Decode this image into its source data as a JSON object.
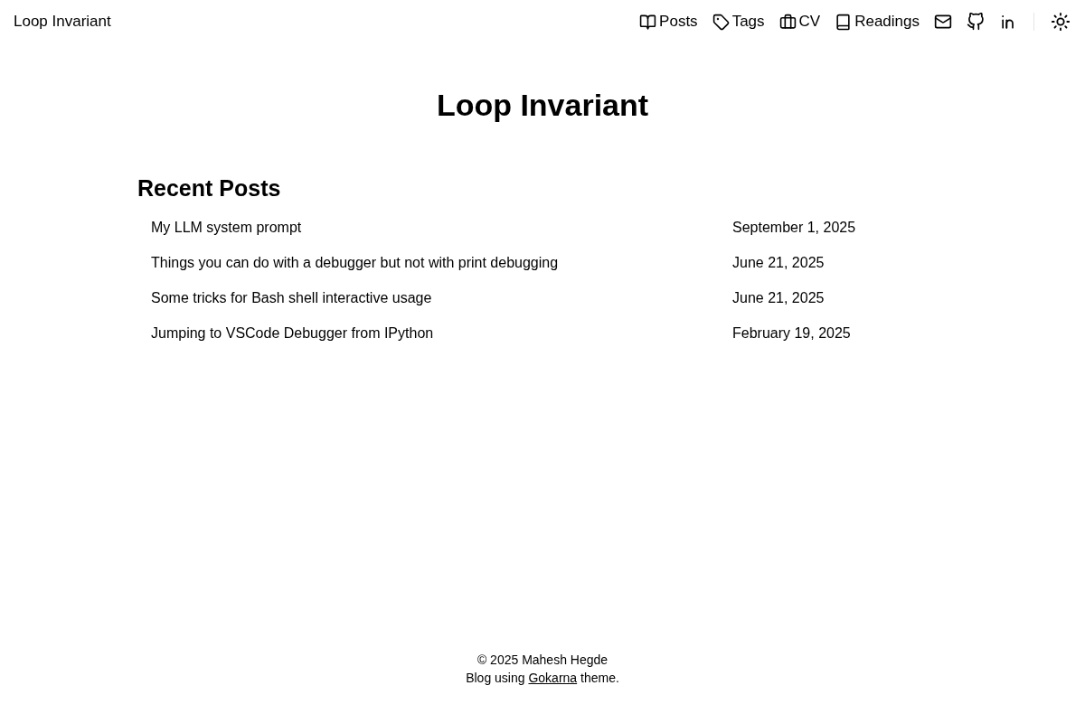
{
  "header": {
    "site_title": "Loop Invariant",
    "nav": [
      {
        "label": "Posts"
      },
      {
        "label": "Tags"
      },
      {
        "label": "CV"
      },
      {
        "label": "Readings"
      }
    ]
  },
  "main": {
    "title": "Loop Invariant",
    "section_title": "Recent Posts",
    "posts": [
      {
        "title": "My LLM system prompt",
        "date": "September 1, 2025"
      },
      {
        "title": "Things you can do with a debugger but not with print debugging",
        "date": "June 21, 2025"
      },
      {
        "title": "Some tricks for Bash shell interactive usage",
        "date": "June 21, 2025"
      },
      {
        "title": "Jumping to VSCode Debugger from IPython",
        "date": "February 19, 2025"
      }
    ]
  },
  "footer": {
    "copyright": "© 2025 Mahesh Hegde",
    "credit_before": "Blog using",
    "credit_link": "Gokarna",
    "credit_after": "theme."
  }
}
